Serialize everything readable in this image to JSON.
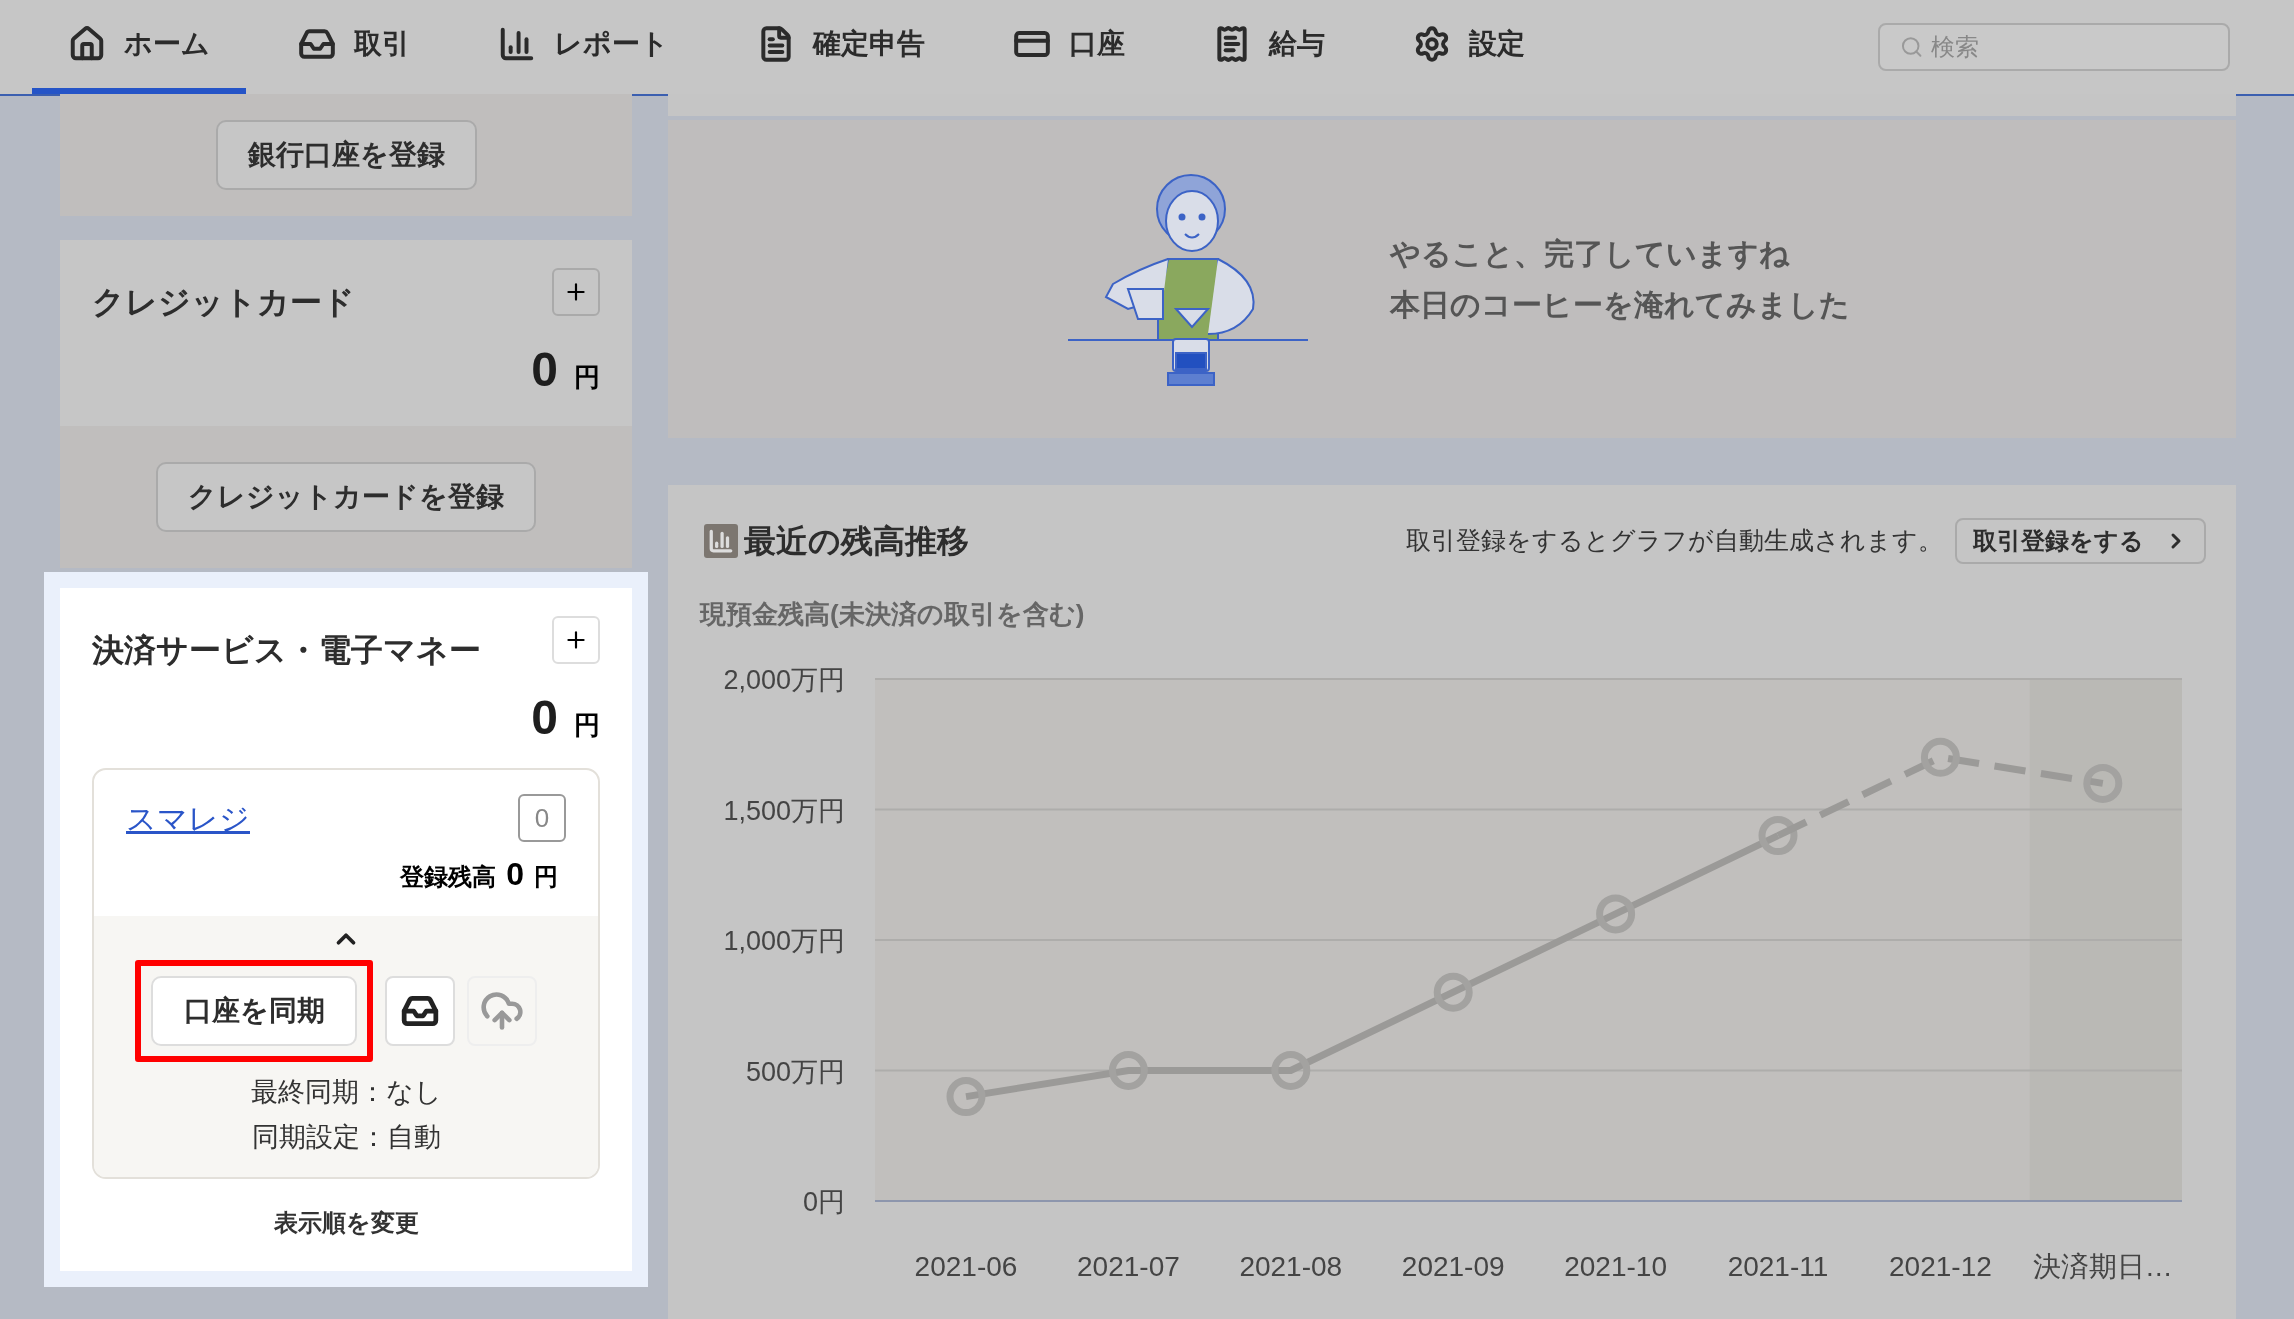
{
  "nav": {
    "items": [
      {
        "kind": "home",
        "label": "ホーム",
        "selected": true
      },
      {
        "kind": "inbox",
        "label": "取引",
        "selected": false
      },
      {
        "kind": "report",
        "label": "レポート",
        "selected": false
      },
      {
        "kind": "tax",
        "label": "確定申告",
        "selected": false
      },
      {
        "kind": "account",
        "label": "口座",
        "selected": false
      },
      {
        "kind": "payroll",
        "label": "給与",
        "selected": false
      },
      {
        "kind": "settings",
        "label": "設定",
        "selected": false
      }
    ],
    "search": {
      "placeholder": "検索"
    }
  },
  "sidebar": {
    "bank_card": {
      "register_button": "銀行口座を登録"
    },
    "credit_card": {
      "title": "クレジットカード",
      "amount": "0",
      "unit": "円",
      "register_button": "クレジットカードを登録"
    },
    "payment_services": {
      "title": "決済サービス・電子マネー",
      "amount": "0",
      "unit": "円",
      "account": {
        "name": "スマレジ",
        "count": "0",
        "balance_label": "登録残高",
        "balance": "0",
        "unit": "円",
        "sync_button": "口座を同期",
        "last_sync": "最終同期：なし",
        "sync_setting": "同期設定：自動"
      },
      "reorder_link": "表示順を変更"
    }
  },
  "todo_panel": {
    "lines": [
      "やること、完了していますね",
      "本日のコーヒーを淹れてみました"
    ]
  },
  "balance_panel": {
    "title": "最近の残高推移",
    "hint": "取引登録をするとグラフが自動生成されます。",
    "action_button": "取引登録をする",
    "subtitle": "現預金残高(未決済の取引を含む)",
    "chart_data": {
      "type": "line",
      "categories": [
        "2021-06",
        "2021-07",
        "2021-08",
        "2021-09",
        "2021-10",
        "2021-11",
        "2021-12",
        "決済期日…"
      ],
      "series": [
        {
          "color": "#9b9a98",
          "line_style": "solid",
          "marker": "circle",
          "values": [
            400,
            500,
            500,
            800,
            1100,
            1400,
            null,
            null
          ]
        },
        {
          "color": "#9b9a98",
          "line_style": "dashed",
          "marker": "circle",
          "values": [
            null,
            null,
            null,
            null,
            null,
            1400,
            1700,
            1600
          ]
        }
      ],
      "grid": true,
      "bands": [
        {
          "axis": "x",
          "from": "決済期日…",
          "to": "決済期日…",
          "color": "#bab9b5"
        }
      ],
      "ylim": [
        0,
        2000
      ],
      "yticks": [
        {
          "value": 0,
          "label": "0円"
        },
        {
          "value": 500,
          "label": "500万円"
        },
        {
          "value": 1000,
          "label": "1,000万円"
        },
        {
          "value": 1500,
          "label": "1,500万円"
        },
        {
          "value": 2000,
          "label": "2,000万円"
        }
      ]
    }
  }
}
